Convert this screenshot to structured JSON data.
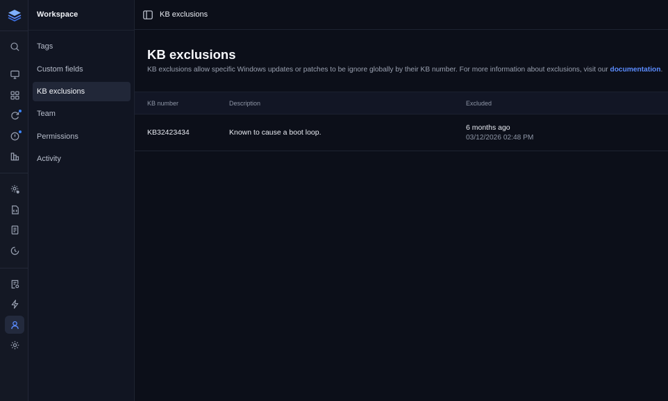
{
  "rail": {
    "items": [
      {
        "name": "search-icon"
      },
      {
        "name": "monitor-icon"
      },
      {
        "name": "grid-icon"
      },
      {
        "name": "refresh-icon"
      },
      {
        "name": "alert-icon"
      },
      {
        "name": "chart-icon"
      },
      {
        "name": "gear-badge-icon"
      },
      {
        "name": "code-file-icon"
      },
      {
        "name": "document-icon"
      },
      {
        "name": "history-icon"
      },
      {
        "name": "report-icon"
      },
      {
        "name": "lightning-icon"
      },
      {
        "name": "user-icon",
        "active": true
      },
      {
        "name": "settings-icon"
      }
    ],
    "accent_color": "#5b8cff",
    "badge_color": "#3b82f6"
  },
  "sidebar": {
    "title": "Workspace",
    "items": [
      {
        "label": "Tags"
      },
      {
        "label": "Custom fields"
      },
      {
        "label": "KB exclusions",
        "active": true
      },
      {
        "label": "Team"
      },
      {
        "label": "Permissions"
      },
      {
        "label": "Activity"
      }
    ]
  },
  "header": {
    "breadcrumb": "KB exclusions"
  },
  "page": {
    "title": "KB exclusions",
    "description": "KB exclusions allow specific Windows updates or patches to be ignore globally by their KB number. For more information about exclusions, visit our ",
    "link_text": "documentation",
    "description_end": "."
  },
  "table": {
    "columns": [
      "KB number",
      "Description",
      "Excluded"
    ],
    "rows": [
      {
        "kb": "KB32423434",
        "description": "Known to cause a boot loop.",
        "excluded_relative": "6 months ago",
        "excluded_date": "03/12/2026 02:48 PM"
      }
    ]
  }
}
